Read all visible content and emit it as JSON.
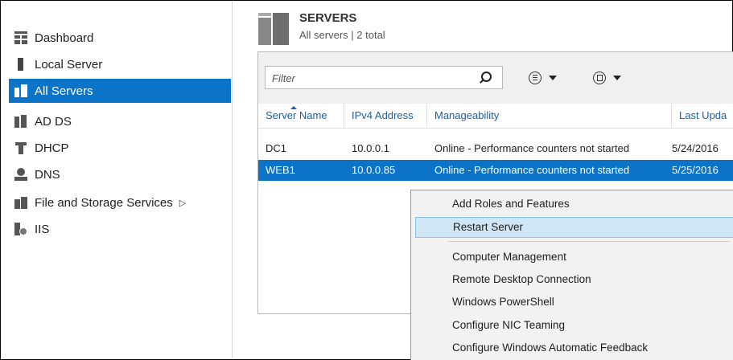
{
  "sidebar": {
    "items": [
      {
        "label": "Dashboard",
        "icon": "dashboard-icon"
      },
      {
        "label": "Local Server",
        "icon": "local-server-icon"
      },
      {
        "label": "All Servers",
        "icon": "all-servers-icon",
        "selected": true
      },
      {
        "label": "AD DS",
        "icon": "ad-ds-icon"
      },
      {
        "label": "DHCP",
        "icon": "dhcp-icon"
      },
      {
        "label": "DNS",
        "icon": "dns-icon"
      },
      {
        "label": "File and Storage Services",
        "icon": "file-storage-icon",
        "has_submenu": true
      },
      {
        "label": "IIS",
        "icon": "iis-icon"
      }
    ],
    "submenu_arrow": "▷"
  },
  "header": {
    "title": "SERVERS",
    "subtitle": "All servers | 2 total"
  },
  "toolbar": {
    "filter_placeholder": "Filter",
    "filter_value": ""
  },
  "table": {
    "columns": [
      "Server Name",
      "IPv4 Address",
      "Manageability",
      "Last Upda"
    ],
    "sorted_column": "Server Name",
    "rows": [
      {
        "name": "DC1",
        "ip": "10.0.0.1",
        "manageability": "Online - Performance counters not started",
        "last_update": "5/24/2016",
        "selected": false
      },
      {
        "name": "WEB1",
        "ip": "10.0.0.85",
        "manageability": "Online - Performance counters not started",
        "last_update": "5/25/2016",
        "selected": true
      }
    ]
  },
  "context_menu": {
    "items": [
      {
        "label": "Add Roles and Features"
      },
      {
        "label": "Restart Server",
        "highlighted": true
      },
      {
        "label": "Computer Management"
      },
      {
        "label": "Remote Desktop Connection"
      },
      {
        "label": "Windows PowerShell"
      },
      {
        "label": "Configure NIC Teaming"
      },
      {
        "label": "Configure Windows Automatic Feedback"
      }
    ]
  },
  "colors": {
    "selection": "#0b74c8",
    "link_text": "#1a5fa8",
    "menu_hover": "#cfe6f6"
  }
}
